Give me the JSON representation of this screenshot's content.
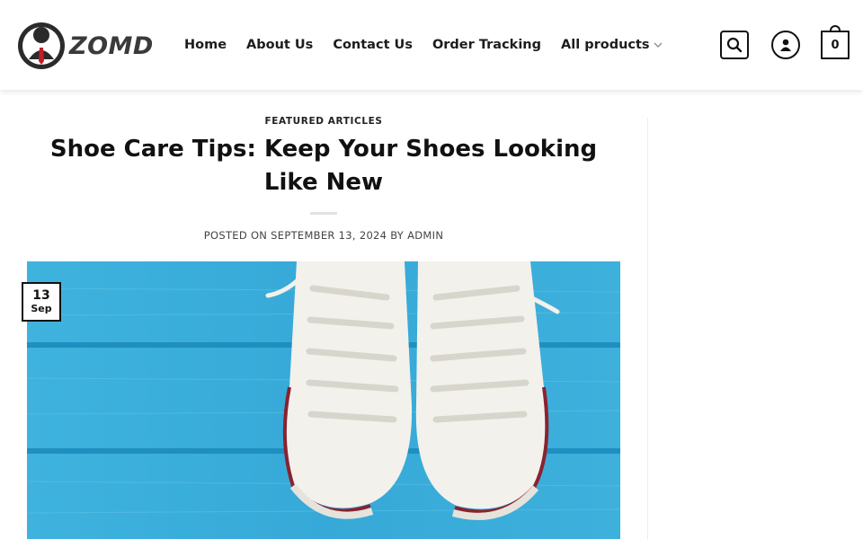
{
  "header": {
    "logo_text": "ZOMD",
    "nav": [
      {
        "label": "Home"
      },
      {
        "label": "About Us"
      },
      {
        "label": "Contact Us"
      },
      {
        "label": "Order Tracking"
      },
      {
        "label": "All products"
      }
    ],
    "cart_count": "0",
    "icons": {
      "search": "search-icon",
      "account": "user-icon",
      "cart": "cart-icon",
      "dropdown": "chevron-down-icon"
    }
  },
  "article": {
    "category": "FEATURED ARTICLES",
    "title": "Shoe Care Tips: Keep Your Shoes Looking Like New",
    "meta": "POSTED ON SEPTEMBER 13, 2024 BY ADMIN",
    "date_badge": {
      "day": "13",
      "month": "Sep"
    }
  },
  "colors": {
    "accent": "#111111",
    "image_background": "#3fb3de",
    "shoe": "#f3f1ec",
    "shoe_stripe": "#8a2230"
  }
}
